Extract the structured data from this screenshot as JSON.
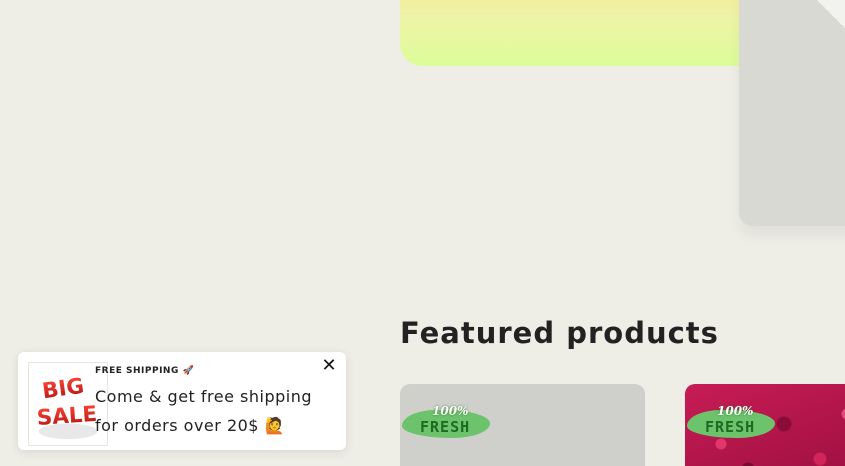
{
  "featured": {
    "title": "Featured products",
    "products": [
      {
        "badge_percent": "100%",
        "badge_word": "FRESH"
      },
      {
        "badge_percent": "100%",
        "badge_word": "FRESH"
      }
    ]
  },
  "popup": {
    "kicker": "FREE SHIPPING 🚀",
    "message": "Come & get free shipping for orders over 20$ 🙋",
    "image_text": "BIG SALE",
    "close_icon": "close-icon"
  },
  "colors": {
    "background": "#efeee6",
    "hero_gradient_top": "#f6e89a",
    "hero_gradient_bottom": "#dcfd9a",
    "fresh_green": "#6cc36b",
    "sale_red": "#e0201e"
  }
}
